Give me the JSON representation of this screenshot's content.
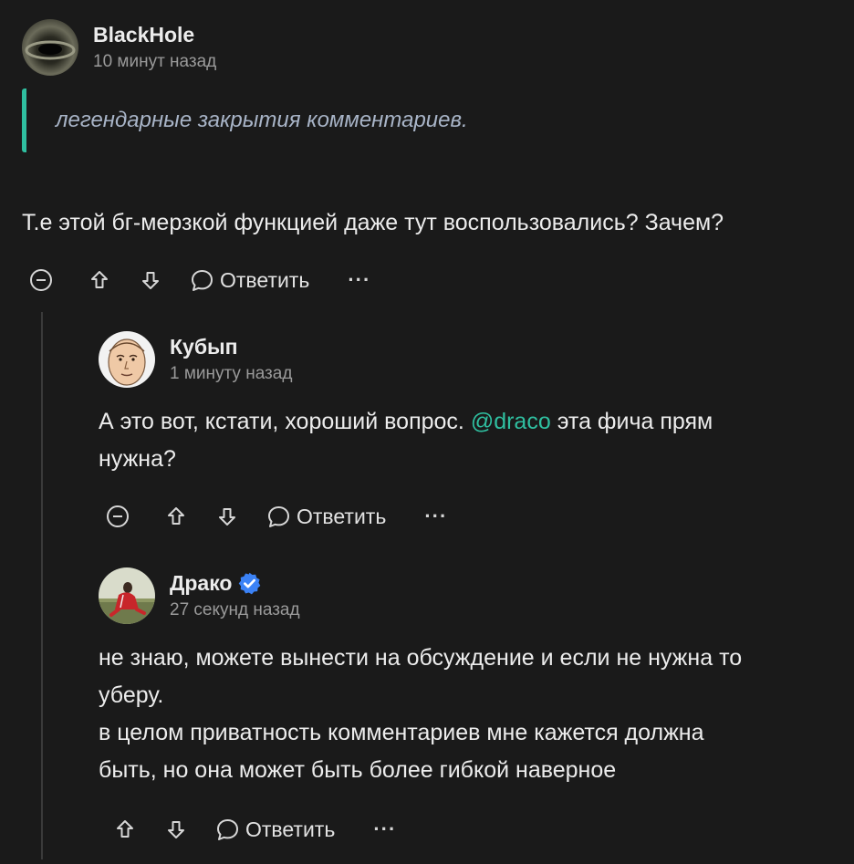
{
  "comments": [
    {
      "author": "BlackHole",
      "time": "10 минут назад",
      "quote": "легендарные закрытия комментариев.",
      "text_lines": [
        "Т.е этой бг-мерзкой функцией даже тут воспользовались? Зачем?"
      ],
      "reply_label": "Ответить",
      "more_label": "···"
    },
    {
      "author": "Кубып",
      "time": "1 минуту назад",
      "text_line1_before": "А это вот, кстати, хороший вопрос. ",
      "mention": "@draco",
      "text_line1_after": " эта фича прям",
      "text_line2": "нужна?",
      "reply_label": "Ответить",
      "more_label": "···"
    },
    {
      "author": "Драко",
      "verified": true,
      "time": "27 секунд назад",
      "text_lines": [
        "не знаю, можете вынести на обсуждение и если не нужна то",
        "уберу.",
        "в целом приватность комментариев мне кажется должна",
        "быть, но она может быть более гибкой наверное"
      ],
      "reply_label": "Ответить",
      "more_label": "···"
    }
  ],
  "colors": {
    "background": "#1a1a1a",
    "accent": "#2fbfa0",
    "verified_badge": "#3b82f6",
    "quote_text": "#a8b4c7"
  }
}
